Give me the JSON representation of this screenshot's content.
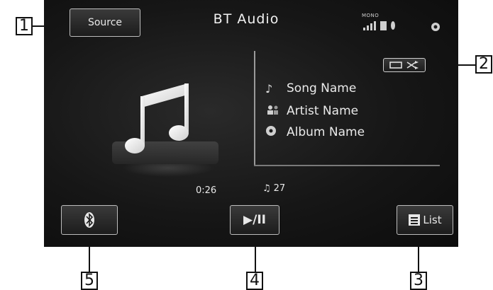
{
  "screen": {
    "title": "BT Audio",
    "status_label": "MONO"
  },
  "buttons": {
    "source_label": "Source",
    "list_label": "List",
    "play_pause_symbol": "▶/II"
  },
  "track": {
    "song_name": "Song Name",
    "artist_name": "Artist Name",
    "album_name": "Album Name",
    "elapsed": "0:26",
    "track_number": "27"
  },
  "callouts": [
    "1",
    "2",
    "3",
    "4",
    "5"
  ],
  "icons": {
    "song": "music-note-icon",
    "artist": "artist-icon",
    "album": "album-icon",
    "bluetooth": "bluetooth-icon",
    "list": "list-icon",
    "repeat": "repeat-icon",
    "shuffle": "shuffle-icon",
    "signal": "signal-bars-icon",
    "battery": "battery-icon",
    "bt_status": "bluetooth-status-icon",
    "settings": "gear-icon",
    "album_art": "music-note-art-icon",
    "track_count": "music-note-count-icon"
  },
  "colors": {
    "screen_bg": "#161616",
    "text": "#eaeaea",
    "button_border": "#bdbdbd",
    "callout_border": "#111111"
  }
}
